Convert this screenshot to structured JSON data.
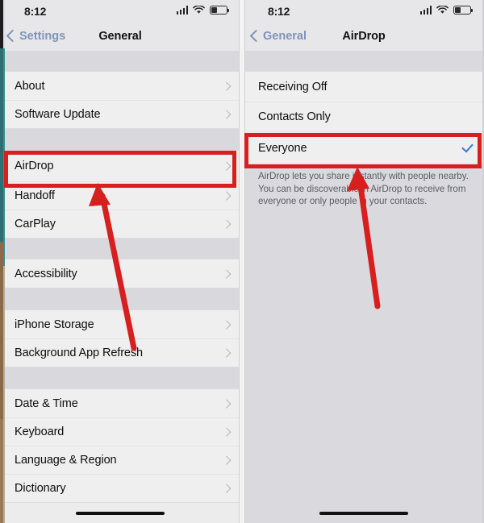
{
  "left_panel": {
    "status_bar": {
      "time": "8:12",
      "signal_icon": "cellular-bars-icon",
      "wifi_icon": "wifi-icon",
      "battery_icon": "battery-icon"
    },
    "nav": {
      "back_label": "Settings",
      "title": "General"
    },
    "groups": [
      {
        "rows": [
          {
            "label": "About",
            "accessory": "chevron"
          },
          {
            "label": "Software Update",
            "accessory": "chevron"
          }
        ]
      },
      {
        "rows": [
          {
            "label": "AirDrop",
            "accessory": "chevron"
          },
          {
            "label": "Handoff",
            "accessory": "chevron"
          },
          {
            "label": "CarPlay",
            "accessory": "chevron"
          }
        ]
      },
      {
        "rows": [
          {
            "label": "Accessibility",
            "accessory": "chevron"
          }
        ]
      },
      {
        "rows": [
          {
            "label": "iPhone Storage",
            "accessory": "chevron"
          },
          {
            "label": "Background App Refresh",
            "accessory": "chevron"
          }
        ]
      },
      {
        "rows": [
          {
            "label": "Date & Time",
            "accessory": "chevron"
          },
          {
            "label": "Keyboard",
            "accessory": "chevron"
          },
          {
            "label": "Language & Region",
            "accessory": "chevron"
          },
          {
            "label": "Dictionary",
            "accessory": "chevron"
          }
        ]
      }
    ]
  },
  "right_panel": {
    "status_bar": {
      "time": "8:12",
      "signal_icon": "cellular-bars-icon",
      "wifi_icon": "wifi-icon",
      "battery_icon": "battery-icon"
    },
    "nav": {
      "back_label": "General",
      "title": "AirDrop"
    },
    "options": [
      {
        "label": "Receiving Off",
        "selected": false
      },
      {
        "label": "Contacts Only",
        "selected": false
      },
      {
        "label": "Everyone",
        "selected": true
      }
    ],
    "footer_note": "AirDrop lets you share instantly with people nearby. You can be discoverable in AirDrop to receive from everyone or only people in your contacts."
  },
  "annotations": {
    "highlight_color": "#d81f1f",
    "arrow_color": "#d81f1f",
    "highlight_left_target": "AirDrop",
    "highlight_right_target": "Everyone"
  },
  "colors": {
    "accent_blue": "#3a7ad4",
    "back_link_blue": "#7f93b8",
    "list_background": "#efeff0",
    "panel_background_right": "#d9d9de",
    "annotation_red": "#d81f1f"
  }
}
